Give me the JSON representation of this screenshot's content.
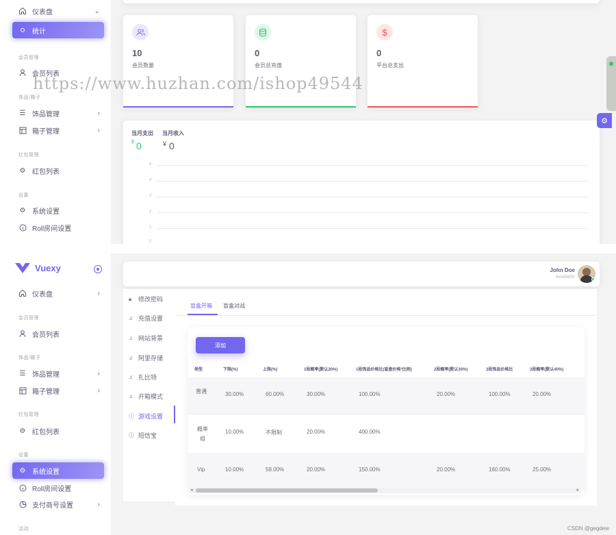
{
  "top": {
    "sidebar": {
      "dashboard": "仪表盘",
      "stats": "统计",
      "sec_member": "会员管理",
      "member_list": "会员列表",
      "sec_jewelry": "饰品/箱子",
      "jewelry_mgmt": "饰品管理",
      "box_mgmt": "箱子管理",
      "sec_redpacket": "红包管理",
      "redpacket_list": "红包列表",
      "sec_settings": "设置",
      "system_settings": "系统设置",
      "roll_settings": "Roll房间设置"
    },
    "stats": [
      {
        "value": "10",
        "label": "会员数量",
        "icon": "users-icon",
        "color": "#7367f0"
      },
      {
        "value": "0",
        "label": "会员总充值",
        "icon": "database-icon",
        "color": "#28c76f"
      },
      {
        "value": "0",
        "label": "平台总支出",
        "icon": "dollar-icon",
        "color": "#ea5455"
      }
    ],
    "chart": {
      "expense_label": "当月支出",
      "expense_currency": "$",
      "expense_value": "0",
      "income_label": "当月收入",
      "income_currency": "¥",
      "income_value": "0",
      "yticks": [
        "5",
        "4",
        "3",
        "2",
        "1",
        "0"
      ]
    }
  },
  "watermark": "https://www.huzhan.com/ishop49544",
  "bottom": {
    "brand": "Vuexy",
    "user_name": "John Doe",
    "user_status": "Available",
    "sidebar": {
      "dashboard": "仪表盘",
      "sec_member": "会员管理",
      "member_list": "会员列表",
      "sec_jewelry": "饰品/箱子",
      "jewelry_mgmt": "饰品管理",
      "box_mgmt": "箱子管理",
      "sec_redpacket": "红包管理",
      "redpacket_list": "红包列表",
      "sec_settings": "设置",
      "system_settings": "系统设置",
      "roll_settings": "Roll房间设置",
      "pay_settings": "支付商号设置",
      "sec_activity": "活动"
    },
    "settings_menu": [
      "修改密码",
      "充值设置",
      "网站背景",
      "阿里存储",
      "扎比特",
      "开箱模式",
      "游戏设置",
      "短信宝"
    ],
    "tabs": [
      "盲盒开箱",
      "盲盒对战"
    ],
    "add_button": "添加",
    "table": {
      "headers": [
        "类型",
        "下限(%)",
        "上限(%)",
        "1段概率(默认20%)",
        "1段饰品价格比(盲盒价格*比例)",
        "2段概率(默认30%)",
        "2段饰品价格比",
        "3段概率(默认40%)"
      ],
      "rows": [
        [
          "普通",
          "30.00%",
          "60.00%",
          "30.00%",
          "100.00%",
          "20.00%",
          "100.00%",
          "20.00%"
        ],
        [
          "概率组",
          "10.00%",
          "不限制",
          "20.00%",
          "400.00%",
          "",
          "",
          ""
        ],
        [
          "Vip",
          "10.00%",
          "58.00%",
          "20.00%",
          "150.00%",
          "20.00%",
          "160.00%",
          "25.00%"
        ]
      ]
    },
    "footer": "CSDN @gegdew"
  }
}
